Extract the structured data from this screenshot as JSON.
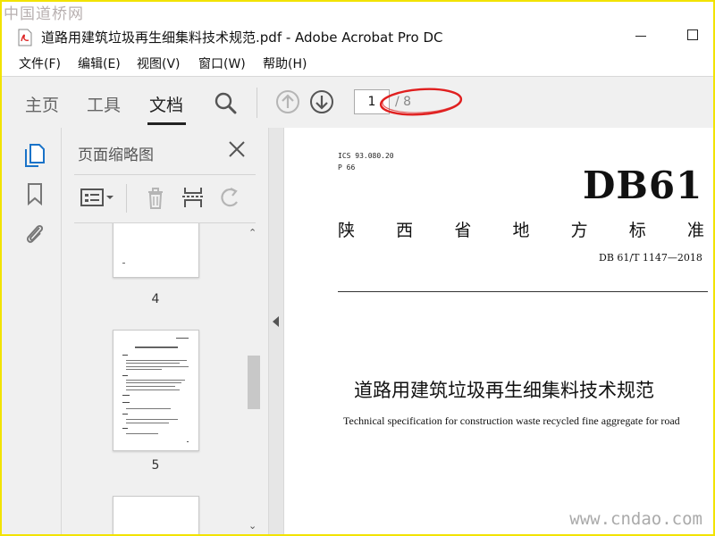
{
  "watermark": {
    "top": "中国道桥网",
    "bottom": "www.cndao.com"
  },
  "window": {
    "title": "道路用建筑垃圾再生细集料技术规范.pdf - Adobe Acrobat Pro DC",
    "icon": "pdf-file-icon"
  },
  "menu": [
    "文件(F)",
    "编辑(E)",
    "视图(V)",
    "窗口(W)",
    "帮助(H)"
  ],
  "toolbar": {
    "tabs": [
      {
        "label": "主页",
        "active": false
      },
      {
        "label": "工具",
        "active": false
      },
      {
        "label": "文档",
        "active": true
      }
    ],
    "icons": [
      "search-icon",
      "page-up-icon",
      "page-down-icon"
    ],
    "current_page": "1",
    "total_pages": "/ 8",
    "annotation_color": "#e02020"
  },
  "rail": {
    "icons": [
      "page-thumbnails-icon",
      "bookmark-icon",
      "attachment-icon"
    ]
  },
  "panel": {
    "title": "页面缩略图",
    "tool_icons": [
      "thumbnail-options-icon",
      "delete-icon",
      "extract-pages-icon",
      "rotate-icon"
    ],
    "thumbnails": [
      {
        "label": "4"
      },
      {
        "label": "5"
      }
    ]
  },
  "document": {
    "ics": "ICS 93.080.20",
    "p_code": "P 66",
    "db": "DB61",
    "province": [
      "陕",
      "西",
      "省",
      "地",
      "方",
      "标",
      "准"
    ],
    "standard_no": "DB 61/T 1147—2018",
    "title_cn": "道路用建筑垃圾再生细集料技术规范",
    "title_en": "Technical specification for construction waste recycled fine aggregate for road"
  },
  "colors": {
    "accent": "#1a73c8",
    "chrome": "#f0f0f0"
  }
}
